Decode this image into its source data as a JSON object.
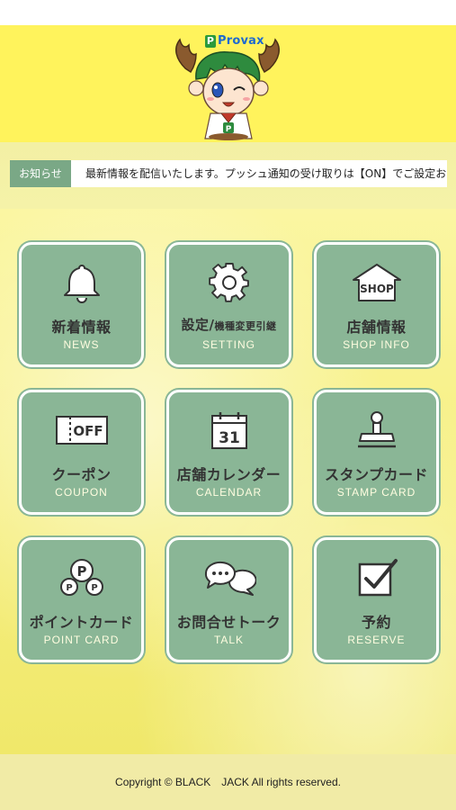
{
  "header": {
    "brand": "Provax"
  },
  "news": {
    "label": "お知らせ",
    "ticker": "最新情報を配信いたします。プッシュ通知の受け取りは【ON】でご設定お"
  },
  "tiles": [
    {
      "icon": "bell-icon",
      "jp": "新着情報",
      "en": "NEWS"
    },
    {
      "icon": "gear-icon",
      "jp_main": "設定/",
      "jp_small": "機種変更引継",
      "en": "SETTING"
    },
    {
      "icon": "shop-icon",
      "icon_text": "SHOP",
      "jp": "店舗情報",
      "en": "SHOP INFO"
    },
    {
      "icon": "coupon-icon",
      "icon_text": "OFF",
      "jp": "クーポン",
      "en": "COUPON"
    },
    {
      "icon": "calendar-icon",
      "icon_text": "31",
      "jp": "店舗カレンダー",
      "en": "CALENDAR"
    },
    {
      "icon": "stamp-icon",
      "jp": "スタンプカード",
      "en": "STAMP CARD"
    },
    {
      "icon": "point-card-icon",
      "icon_text": "P",
      "jp": "ポイントカード",
      "en": "POINT CARD"
    },
    {
      "icon": "talk-icon",
      "jp": "お問合せトーク",
      "en": "TALK"
    },
    {
      "icon": "reserve-check-icon",
      "jp": "予約",
      "en": "RESERVE"
    }
  ],
  "footer": {
    "copyright": "Copyright © BLACK　JACK All rights reserved."
  }
}
